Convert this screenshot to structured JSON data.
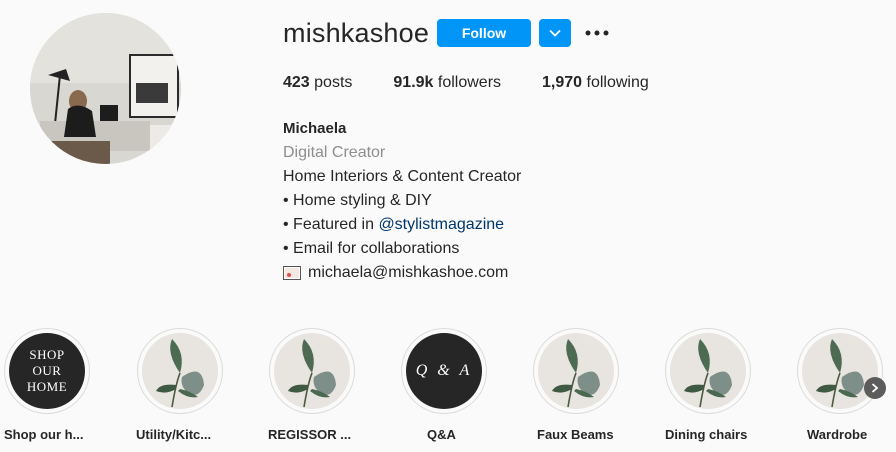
{
  "profile": {
    "username": "mishkashoe",
    "follow_label": "Follow",
    "avatar_icon": "profile-photo",
    "stats": [
      {
        "value": "423",
        "label": " posts"
      },
      {
        "value": "91.9k",
        "label": " followers"
      },
      {
        "value": "1,970",
        "label": " following"
      }
    ],
    "bio": {
      "name": "Michaela",
      "category": "Digital Creator",
      "line1": "Home Interiors & Content Creator",
      "line2": "• Home styling & DIY",
      "line3_prefix": "• Featured in ",
      "line3_mention": "@stylistmagazine",
      "line4": "• Email for collaborations",
      "email": "michaela@mishkashoe.com"
    }
  },
  "highlights": [
    {
      "label": "Shop our h...",
      "cover_text": "SHOP OUR HOME",
      "style": "dark"
    },
    {
      "label": "Utility/Kitc...",
      "style": "plant"
    },
    {
      "label": "REGISSOR ...",
      "style": "plant"
    },
    {
      "label": "Q&A",
      "cover_text": "Q & A",
      "style": "dark"
    },
    {
      "label": "Faux Beams",
      "style": "plant"
    },
    {
      "label": "Dining chairs",
      "style": "plant"
    },
    {
      "label": "Wardrobe",
      "style": "plant"
    }
  ],
  "colors": {
    "accent": "#0095f6",
    "mention": "#00376b",
    "muted": "#8e8e8e"
  }
}
